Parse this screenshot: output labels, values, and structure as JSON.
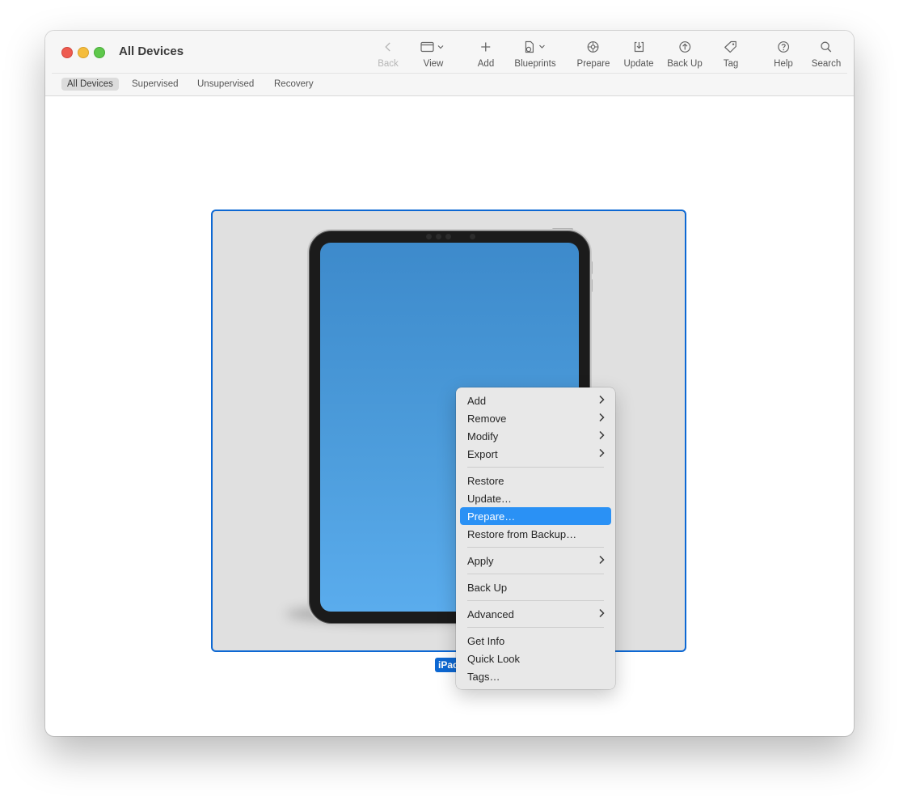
{
  "window": {
    "title": "All Devices"
  },
  "toolbar": {
    "back": "Back",
    "view": "View",
    "add": "Add",
    "blueprints": "Blueprints",
    "prepare": "Prepare",
    "update": "Update",
    "back_up": "Back Up",
    "tag": "Tag",
    "help": "Help",
    "search": "Search"
  },
  "scope_tabs": [
    "All Devices",
    "Supervised",
    "Unsupervised",
    "Recovery"
  ],
  "device": {
    "label_visible": "iPac"
  },
  "context_menu": {
    "add": "Add",
    "remove": "Remove",
    "modify": "Modify",
    "export": "Export",
    "restore": "Restore",
    "update": "Update…",
    "prepare": "Prepare…",
    "restore_from_backup": "Restore from Backup…",
    "apply": "Apply",
    "back_up": "Back Up",
    "advanced": "Advanced",
    "get_info": "Get Info",
    "quick_look": "Quick Look",
    "tags": "Tags…",
    "highlighted": "Prepare…"
  },
  "colors": {
    "accent": "#0d68d3",
    "menu_highlight": "#2a91f5",
    "close": "#ee5b50",
    "minimize": "#f5bd3c",
    "zoom": "#5fc84c"
  }
}
